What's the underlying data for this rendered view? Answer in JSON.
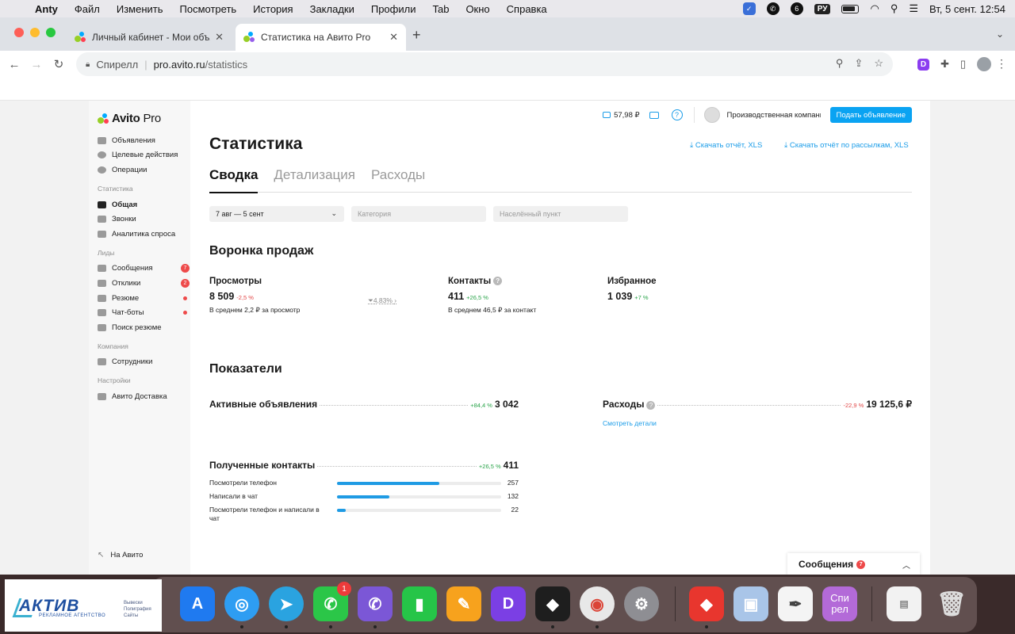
{
  "menubar": {
    "app": "Anty",
    "items": [
      "Файл",
      "Изменить",
      "Посмотреть",
      "История",
      "Закладки",
      "Профили",
      "Tab",
      "Окно",
      "Справка"
    ],
    "lang": "РУ",
    "clock": "Вт, 5 сент.  12:54"
  },
  "browser": {
    "tabs": [
      {
        "label": "Личный кабинет - Мои объя...",
        "active": false
      },
      {
        "label": "Статистика на Авито Pro",
        "active": true
      }
    ],
    "address": {
      "site": "Спирелл",
      "host": "pro.avito.ru",
      "path": "/statistics"
    }
  },
  "sidebar": {
    "logo": "Avito",
    "logo_suffix": "Pro",
    "items_top": [
      "Объявления",
      "Целевые действия",
      "Операции"
    ],
    "group_stats": "Статистика",
    "items_stats": [
      "Общая",
      "Звонки",
      "Аналитика спроса"
    ],
    "group_leads": "Лиды",
    "items_leads": [
      {
        "label": "Сообщения",
        "badge": "7"
      },
      {
        "label": "Отклики",
        "badge": "2"
      },
      {
        "label": "Резюме",
        "badge": ""
      },
      {
        "label": "Чат-боты",
        "badge": ""
      },
      {
        "label": "Поиск резюме",
        "badge": ""
      }
    ],
    "group_company": "Компания",
    "items_company": [
      "Сотрудники"
    ],
    "group_settings": "Настройки",
    "items_settings": [
      "Авито Доставка"
    ],
    "footer_link": "На Авито"
  },
  "header": {
    "balance": "57,98 ₽",
    "company": "Производственная компания",
    "post_button": "Подать объявление"
  },
  "page": {
    "title": "Статистика",
    "download_report": "Скачать отчёт, XLS",
    "download_mailings": "Скачать отчёт по рассылкам, XLS",
    "tabs": [
      "Сводка",
      "Детализация",
      "Расходы"
    ],
    "filters": {
      "date": "7 авг — 5 сент",
      "category_placeholder": "Категория",
      "city_placeholder": "Населённый пункт"
    }
  },
  "funnel": {
    "title": "Воронка продаж",
    "views": {
      "label": "Просмотры",
      "value": "8 509",
      "change": "-2,5 %",
      "sub": "В среднем 2,2 ₽ за просмотр"
    },
    "conversion": "4,83%",
    "contacts": {
      "label": "Контакты",
      "value": "411",
      "change": "+26,5 %",
      "sub": "В среднем 46,5 ₽ за контакт"
    },
    "favorites": {
      "label": "Избранное",
      "value": "1 039",
      "change": "+7 %"
    }
  },
  "indicators": {
    "title": "Показатели",
    "active_ads": {
      "label": "Активные объявления",
      "change": "+84,4 %",
      "value": "3 042"
    },
    "expenses": {
      "label": "Расходы",
      "change": "-22,9 %",
      "value": "19 125,6 ₽",
      "link": "Смотреть детали"
    },
    "contacts": {
      "label": "Полученные контакты",
      "change": "+26,5 %",
      "value": "411",
      "rows": [
        {
          "label": "Посмотрели телефон",
          "value": "257",
          "share": 0.625
        },
        {
          "label": "Написали в чат",
          "value": "132",
          "share": 0.321
        },
        {
          "label": "Посмотрели телефон и написали в чат",
          "value": "22",
          "share": 0.054
        }
      ]
    }
  },
  "messages_widget": {
    "label": "Сообщения",
    "badge": "7"
  },
  "dock": {
    "whatsapp_badge": "1",
    "spirel": "Спи рел"
  },
  "watermark": {
    "brand": "АКТИВ",
    "tagline": "РЕКЛАМНОЕ АГЕНТСТВО",
    "services": [
      "Вывески",
      "Полиграфия",
      "Сайты"
    ]
  },
  "colors": {
    "accent": "#1a9ce8",
    "button": "#0aa3f2",
    "positive": "#2aa44a",
    "negative": "#e24848",
    "bar": "#1f9be4"
  }
}
